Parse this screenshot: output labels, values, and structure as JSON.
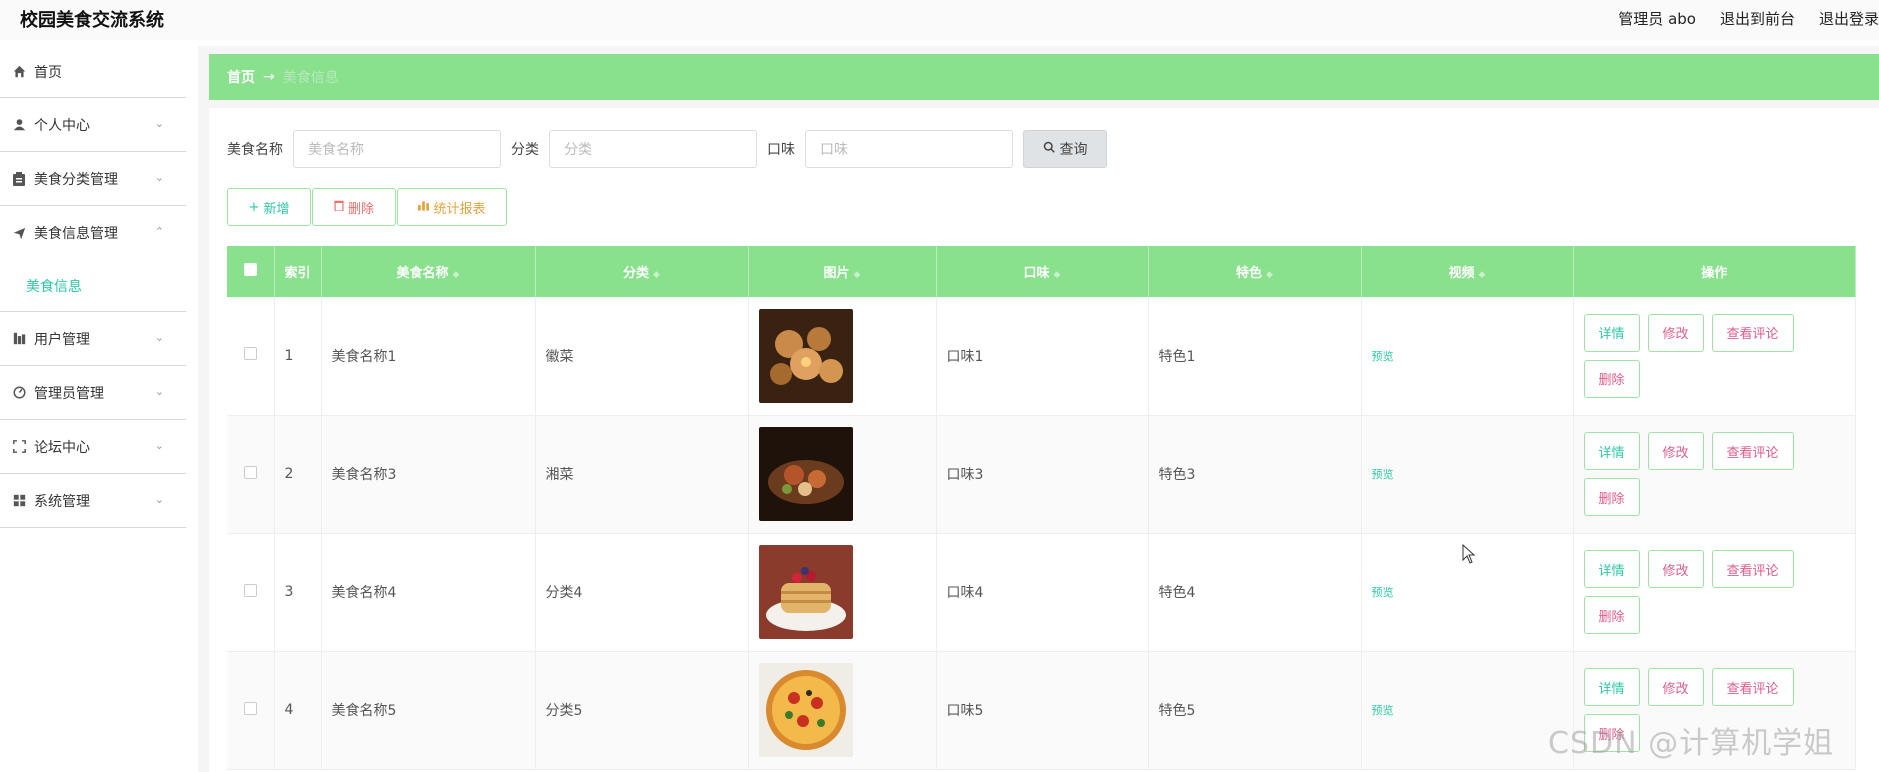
{
  "app": {
    "title": "校园美食交流系统"
  },
  "top": {
    "admin": "管理员 abo",
    "to_front": "退出到前台",
    "logout": "退出登录"
  },
  "sidebar": {
    "items": [
      {
        "label": "首页",
        "icon": "home-icon"
      },
      {
        "label": "个人中心",
        "icon": "user-icon"
      },
      {
        "label": "美食分类管理",
        "icon": "clipboard-icon"
      },
      {
        "label": "美食信息管理",
        "icon": "send-icon"
      },
      {
        "label": "用户管理",
        "icon": "chart-icon"
      },
      {
        "label": "管理员管理",
        "icon": "dashboard-icon"
      },
      {
        "label": "论坛中心",
        "icon": "fullscreen-icon"
      },
      {
        "label": "系统管理",
        "icon": "grid-icon"
      }
    ],
    "sub_item": "美食信息"
  },
  "breadcrumb": {
    "home": "首页",
    "arrow": "→",
    "current": "美食信息"
  },
  "search": {
    "name_label": "美食名称",
    "name_placeholder": "美食名称",
    "category_label": "分类",
    "category_placeholder": "分类",
    "taste_label": "口味",
    "taste_placeholder": "口味",
    "query": "查询"
  },
  "actions": {
    "add": "新增",
    "delete": "删除",
    "stats": "统计报表"
  },
  "table": {
    "headers": [
      "索引",
      "美食名称",
      "分类",
      "图片",
      "口味",
      "特色",
      "视频",
      "操作"
    ],
    "rows": [
      {
        "index": "1",
        "name": "美食名称1",
        "category": "徽菜",
        "taste": "口味1",
        "feature": "特色1",
        "video": "预览"
      },
      {
        "index": "2",
        "name": "美食名称3",
        "category": "湘菜",
        "taste": "口味3",
        "feature": "特色3",
        "video": "预览"
      },
      {
        "index": "3",
        "name": "美食名称4",
        "category": "分类4",
        "taste": "口味4",
        "feature": "特色4",
        "video": "预览"
      },
      {
        "index": "4",
        "name": "美食名称5",
        "category": "分类5",
        "taste": "口味5",
        "feature": "特色5",
        "video": "预览"
      }
    ],
    "ops": {
      "detail": "详情",
      "edit": "修改",
      "comment": "查看评论",
      "remove": "删除"
    }
  },
  "watermark": "CSDN @计算机学姐",
  "colors": {
    "accent_green": "#89e08d",
    "teal": "#2ec7a6",
    "danger": "#f56c6c",
    "warning": "#e6a23c"
  }
}
